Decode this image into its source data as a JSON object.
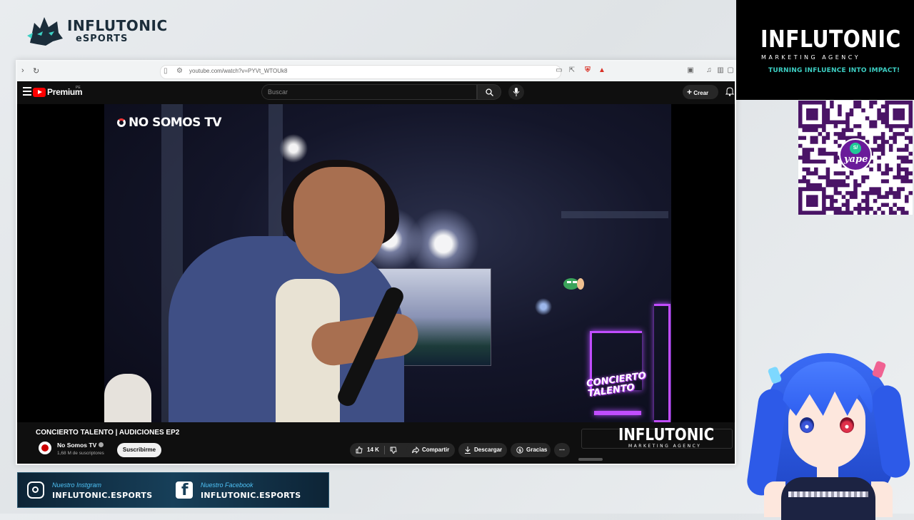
{
  "esports_logo": {
    "brand": "INFLUTONIC",
    "sub": "eSPORTS"
  },
  "browser": {
    "url": "youtube.com/watch?v=PYVt_WTOUk8"
  },
  "youtube": {
    "premium_label": "Premium",
    "country_code": "PE",
    "search_placeholder": "Buscar",
    "create_label": "Crear",
    "video": {
      "overlay_channel_logo": "NO SOMOS TV",
      "overlay_badge_line1": "CONCIERTO",
      "overlay_badge_line2": "TALENTO"
    },
    "title": "CONCIERTO TALENTO | AUDICIONES EP2",
    "channel": {
      "name": "No Somos TV",
      "subscribers": "1,68 M de suscriptores"
    },
    "subscribe_label": "Suscribirme",
    "actions": {
      "likes": "14 K",
      "share": "Compartir",
      "download": "Descargar",
      "thanks": "Gracias",
      "more": "⋯"
    }
  },
  "overlay_logo": {
    "title": "INFLUTONIC",
    "sub": "MARKETING AGENCY"
  },
  "agency_panel": {
    "title": "INFLUTONIC",
    "sub": "MARKETING AGENCY",
    "tagline": "TURNING INFLUENCE INTO IMPACT!"
  },
  "qr": {
    "badge_currency": "S/",
    "badge_brand": "yape"
  },
  "social": {
    "instagram_label": "Nuestro Instgram",
    "instagram_handle": "INFLUTONIC.ESPORTS",
    "facebook_label": "Nuestro Facebook",
    "facebook_handle": "INFLUTONIC.ESPORTS"
  },
  "colors": {
    "accent_teal": "#3ccfc3",
    "yt_red": "#ff0000",
    "social_bg": "#173f59"
  },
  "icons": [
    "menu-icon",
    "search-icon",
    "mic-icon",
    "bell-icon",
    "like-icon",
    "dislike-icon",
    "share-icon",
    "download-icon",
    "thanks-icon",
    "instagram-icon",
    "facebook-icon"
  ]
}
